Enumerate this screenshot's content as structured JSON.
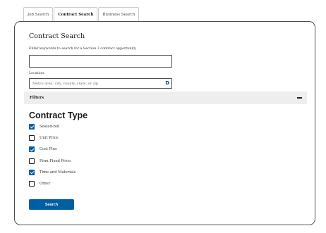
{
  "tabs": [
    {
      "label": "Job Search",
      "active": false
    },
    {
      "label": "Contract Search",
      "active": true
    },
    {
      "label": "Business Search",
      "active": false
    }
  ],
  "form": {
    "title": "Contract Search",
    "keyword_hint": "Enter keywords to search for a Section 3 contract opportunity.",
    "keyword_value": "",
    "location_label": "Location:",
    "location_placeholder": "Metro area, city, county, state, or zip",
    "location_icon": "location-arrow-icon",
    "location_icon_glyph": "D"
  },
  "filters": {
    "label": "Filters",
    "expanded": true,
    "contract_type": {
      "heading": "Contract Type",
      "options": [
        {
          "label": "Sealed-bid",
          "checked": true
        },
        {
          "label": "Unit Price",
          "checked": false
        },
        {
          "label": "Cost Plus",
          "checked": true
        },
        {
          "label": "Firm Fixed Price",
          "checked": false
        },
        {
          "label": "Time and Materials",
          "checked": true
        },
        {
          "label": "Other",
          "checked": false
        }
      ]
    }
  },
  "actions": {
    "search_label": "Search"
  },
  "colors": {
    "primary": "#005ea2",
    "filters_bar": "#eeeeee",
    "border": "#4b4f57"
  }
}
